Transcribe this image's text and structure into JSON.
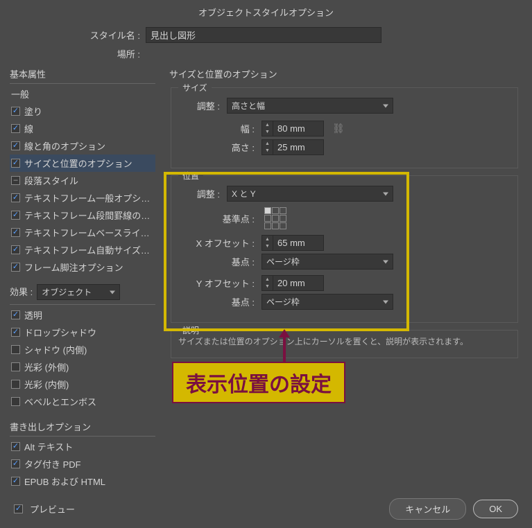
{
  "dialog": {
    "title": "オブジェクトスタイルオプション"
  },
  "header": {
    "style_name_label": "スタイル名 :",
    "style_name_value": "見出し図形",
    "location_label": "場所 :"
  },
  "left": {
    "basic_attrs_head": "基本属性",
    "items": [
      {
        "label": "一般",
        "checked": "none"
      },
      {
        "label": "塗り",
        "checked": "on"
      },
      {
        "label": "線",
        "checked": "on"
      },
      {
        "label": "線と角のオプション",
        "checked": "on"
      },
      {
        "label": "サイズと位置のオプション",
        "checked": "on",
        "selected": true
      },
      {
        "label": "段落スタイル",
        "checked": "mixed"
      },
      {
        "label": "テキストフレーム一般オプション",
        "checked": "on"
      },
      {
        "label": "テキストフレーム段間罫線のオプション",
        "checked": "on"
      },
      {
        "label": "テキストフレームベースラインオプション",
        "checked": "on"
      },
      {
        "label": "テキストフレーム自動サイズ調整オプション",
        "checked": "on"
      },
      {
        "label": "フレーム脚注オプション",
        "checked": "on"
      }
    ],
    "effects_head": "効果 :",
    "effects_select": "オブジェクト",
    "effects_items": [
      {
        "label": "透明",
        "checked": "on"
      },
      {
        "label": "ドロップシャドウ",
        "checked": "on"
      },
      {
        "label": "シャドウ (内側)",
        "checked": "off"
      },
      {
        "label": "光彩 (外側)",
        "checked": "off"
      },
      {
        "label": "光彩 (内側)",
        "checked": "off"
      },
      {
        "label": "ベベルとエンボス",
        "checked": "off"
      }
    ],
    "export_head": "書き出しオプション",
    "export_items": [
      {
        "label": "Alt テキスト",
        "checked": "on"
      },
      {
        "label": "タグ付き PDF",
        "checked": "on"
      },
      {
        "label": "EPUB および HTML",
        "checked": "on"
      }
    ]
  },
  "right": {
    "title": "サイズと位置のオプション",
    "size_group": {
      "title": "サイズ",
      "adjust_label": "調整 :",
      "adjust_value": "高さと幅",
      "width_label": "幅 :",
      "width_value": "80 mm",
      "height_label": "高さ :",
      "height_value": "25 mm"
    },
    "pos_group": {
      "title": "位置",
      "adjust_label": "調整 :",
      "adjust_value": "X と Y",
      "refpoint_label": "基準点 :",
      "xoffset_label": "X オフセット :",
      "xoffset_value": "65 mm",
      "xbase_label": "基点 :",
      "xbase_value": "ページ枠",
      "yoffset_label": "Y オフセット :",
      "yoffset_value": "20 mm",
      "ybase_label": "基点 :",
      "ybase_value": "ページ枠"
    },
    "desc_group": {
      "title": "説明",
      "text": "サイズまたは位置のオプション上にカーソルを置くと、説明が表示されます。"
    }
  },
  "annotation": {
    "text": "表示位置の設定"
  },
  "footer": {
    "preview_label": "プレビュー",
    "cancel": "キャンセル",
    "ok": "OK"
  }
}
